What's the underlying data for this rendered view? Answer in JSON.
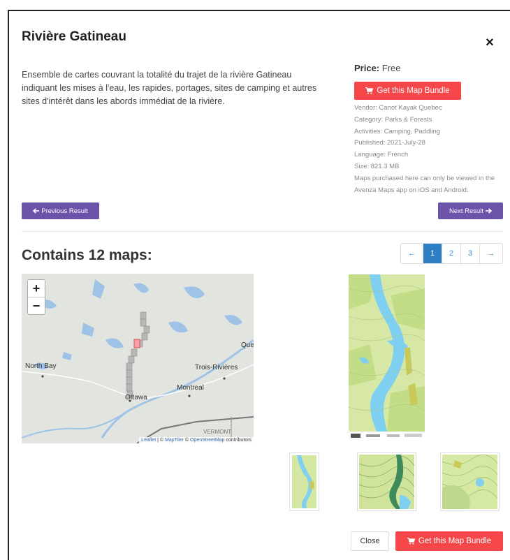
{
  "modal": {
    "title": "Rivière Gatineau",
    "close_glyph": "×",
    "description": "Ensemble de cartes couvrant la totalité du trajet de la rivière Gatineau indiquant les mises à l'eau, les rapides, portages, sites de camping et autres sites d'intérêt dans les abords immédiat de la rivière."
  },
  "details": {
    "price_label": "Price:",
    "price_value": "Free",
    "buy_label": "Get this Map Bundle",
    "meta": [
      "Vendor: Canot Kayak Quebec",
      "Category: Parks & Forests",
      "Activities: Camping, Paddling",
      "Published: 2021-July-28",
      "Language: French",
      "Size: 821.3 MB",
      "Maps purchased here can only be viewed in the Avenza Maps app on iOS and Android."
    ]
  },
  "nav": {
    "prev_label": "Previous Result",
    "next_label": "Next Result"
  },
  "contains": {
    "heading": "Contains 12 maps:"
  },
  "pagination": {
    "prev": "←",
    "pages": [
      "1",
      "2",
      "3"
    ],
    "next": "→",
    "active": "1"
  },
  "map": {
    "zoom_in": "+",
    "zoom_out": "−",
    "labels": {
      "north_bay": "North Bay",
      "trois_rivieres": "Trois-Rivières",
      "que": "Que",
      "montreal": "Montreal",
      "ottawa": "Ottawa",
      "vermont": "VERMONT"
    },
    "attribution": {
      "leaflet": "Leaflet",
      "sep1": " | © ",
      "maptiler": "MapTiler",
      "sep2": " © ",
      "osm": "OpenStreetMap",
      "suffix": " contributors"
    }
  },
  "footer": {
    "close_label": "Close",
    "buy_label": "Get this Map Bundle"
  },
  "colors": {
    "red": "#f5474a",
    "purple": "#6a53a9",
    "blue": "#2f7fc4"
  }
}
